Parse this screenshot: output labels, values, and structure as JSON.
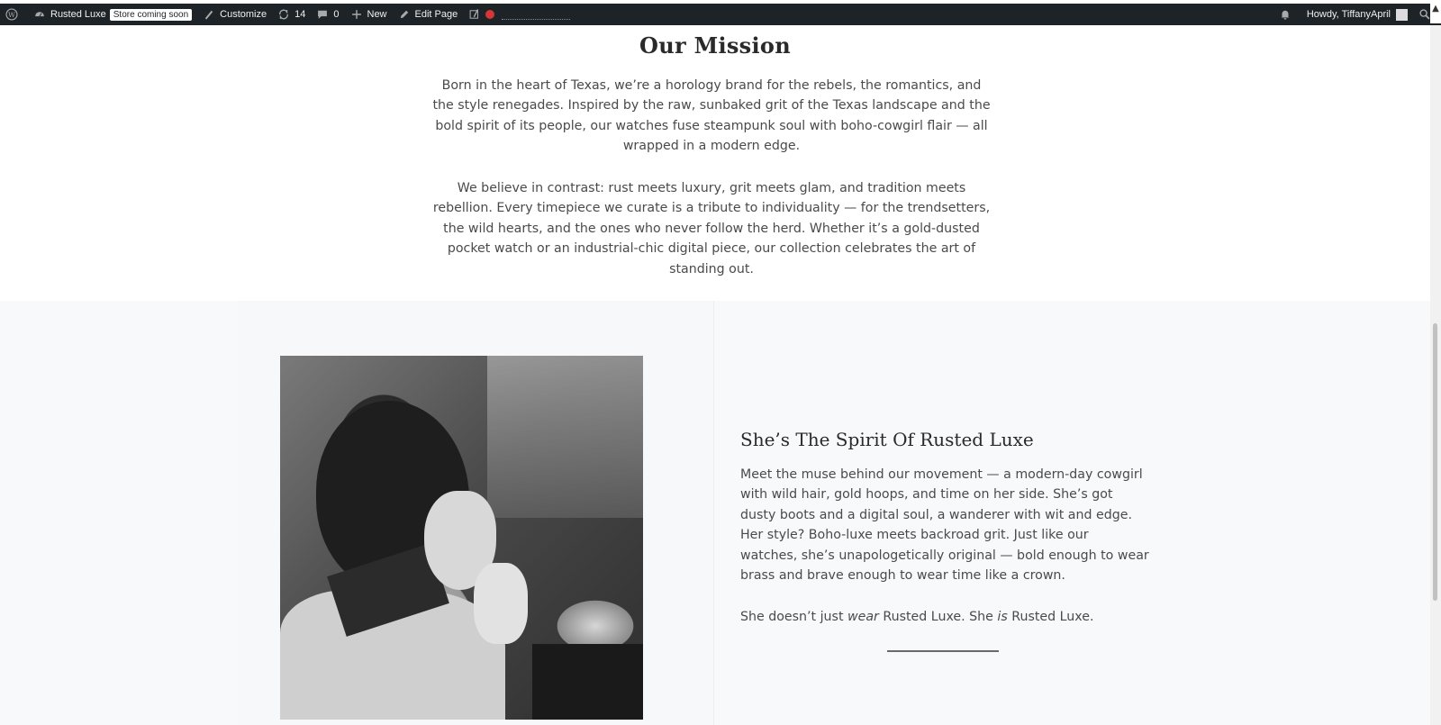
{
  "adminbar": {
    "site_name": "Rusted Luxe",
    "store_badge": "Store coming soon",
    "customize": "Customize",
    "updates_count": "14",
    "comments_count": "0",
    "new": "New",
    "edit_page": "Edit Page",
    "howdy": "Howdy, TiffanyApril"
  },
  "mission": {
    "title": "Our Mission",
    "paragraph1": "Born in the heart of Texas, we’re a horology brand for the rebels, the romantics, and the style renegades. Inspired by the raw, sunbaked grit of the Texas landscape and the bold spirit of its people, our watches fuse steampunk soul with boho-cowgirl flair — all wrapped in a modern edge.",
    "paragraph2": "We believe in contrast: rust meets luxury, grit meets glam, and tradition meets rebellion. Every timepiece we curate is a tribute to individuality — for the trendsetters, the wild hearts, and the ones who never follow the herd. Whether it’s a gold-dusted pocket watch or an industrial-chic digital piece, our collection celebrates the art of standing out."
  },
  "spirit": {
    "title": "She’s The Spirit Of Rusted Luxe",
    "paragraph1": "Meet the muse behind our movement — a modern-day cowgirl with wild hair, gold hoops, and time on her side. She’s got dusty boots and a digital soul, a wanderer with wit and edge. Her style? Boho-luxe meets backroad grit. Just like our watches, she’s unapologetically original — bold enough to wear brass and brave enough to wear time like a crown.",
    "p2_a": "She doesn’t just ",
    "p2_wear": "wear",
    "p2_b": " Rusted Luxe. She ",
    "p2_is": "is",
    "p2_c": " Rusted Luxe."
  },
  "colors": {
    "adminbar_bg": "#1d2327",
    "section_alt_bg": "#f8f9fa",
    "status_dot": "#d63638"
  }
}
